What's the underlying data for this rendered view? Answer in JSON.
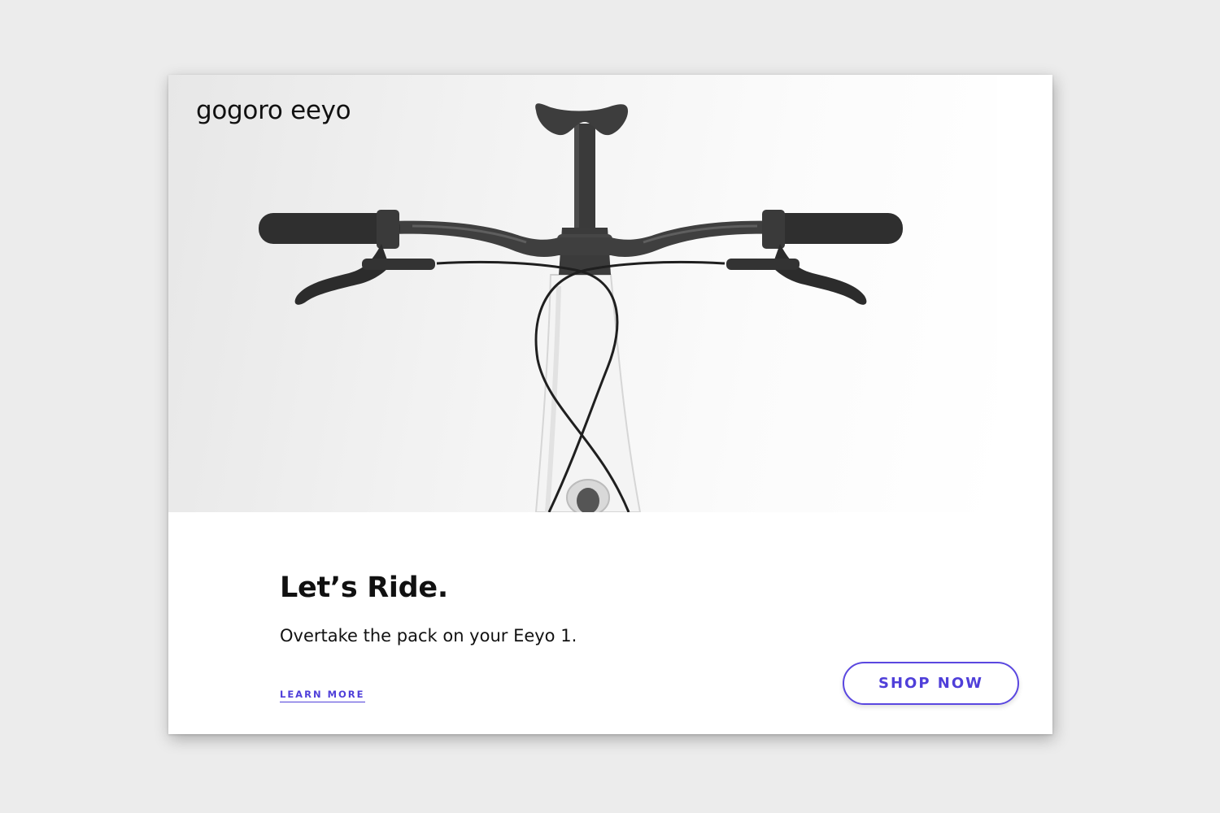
{
  "ad": {
    "logo": "gogoro eeyo",
    "headline": "Let’s Ride.",
    "subline": "Overtake the pack on your Eeyo 1.",
    "learn_more_label": "LEARN MORE",
    "shop_now_label": "SHOP NOW",
    "hero_image": "bicycle-handlebar-photo"
  },
  "colors": {
    "accent": "#4f3fd9",
    "text": "#111111",
    "background": "#ececec",
    "card": "#ffffff"
  }
}
